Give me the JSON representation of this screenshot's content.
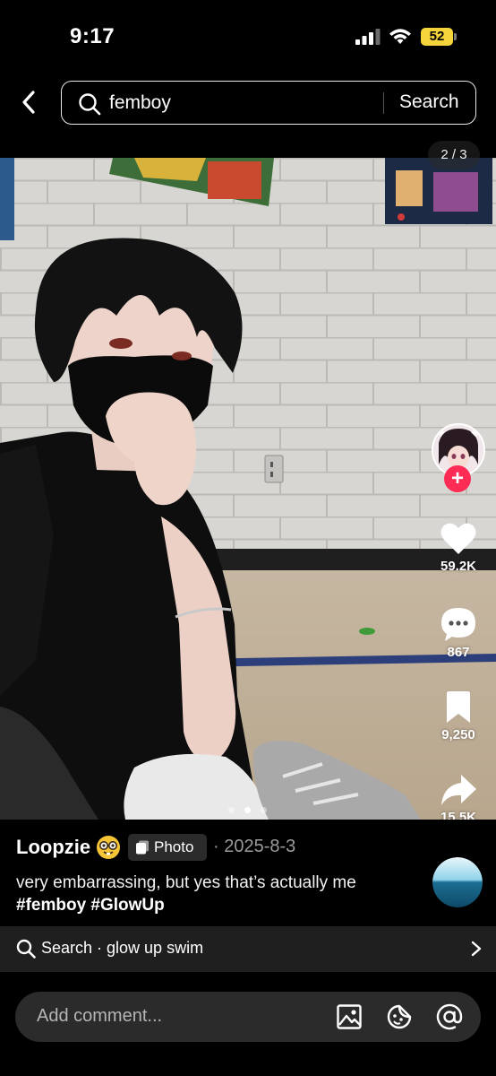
{
  "status_bar": {
    "time": "9:17",
    "battery": "52"
  },
  "header": {
    "query": "femboy",
    "search_label": "Search"
  },
  "photo": {
    "page_indicator": "2 / 3",
    "current_image": 2,
    "total_images": 3
  },
  "actions": {
    "likes": "59.2K",
    "comments": "867",
    "saves": "9,250",
    "shares": "15.5K"
  },
  "post": {
    "author": "Loopzie",
    "badge_label": "Photo",
    "date": "· 2025-8-3",
    "caption_text": "very embarrassing, but yes that’s actually me",
    "hashtags": [
      "#femboy",
      "#GlowUp"
    ]
  },
  "related_search": {
    "text": "Search · glow up swim"
  },
  "comment_bar": {
    "placeholder": "Add comment..."
  },
  "colors": {
    "accent": "#fe2c55",
    "battery": "#f5d33a",
    "badge_bg": "#2b2b2b"
  },
  "icons": [
    "back-icon",
    "search-icon",
    "heart-icon",
    "comment-icon",
    "bookmark-icon",
    "share-icon",
    "image-icon",
    "sticker-icon",
    "mention-icon",
    "chevron-right-icon"
  ]
}
